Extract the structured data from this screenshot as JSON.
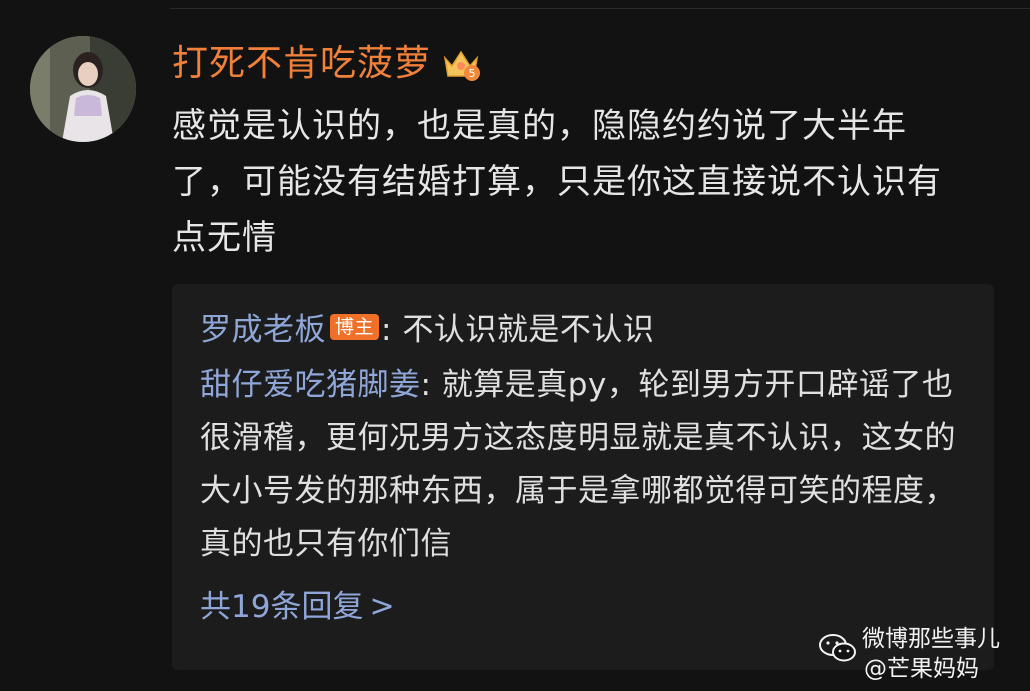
{
  "comment": {
    "username": "打死不肯吃菠萝",
    "badge_icon": "crown-level-badge-icon",
    "text": "感觉是认识的，也是真的，隐隐约约说了大半年了，可能没有结婚打算，只是你这直接说不认识有点无情"
  },
  "replies": [
    {
      "name": "罗成老板",
      "tag": "博主",
      "separator": ":",
      "text": " 不认识就是不认识"
    },
    {
      "name": "甜仔爱吃猪脚姜",
      "separator": ":",
      "text": " 就算是真py，轮到男方开口辟谣了也很滑稽，更何况男方这态度明显就是真不认识，这女的大小号发的那种东西，属于是拿哪都觉得可笑的程度，真的也只有你们信"
    }
  ],
  "more_replies": {
    "label": "共19条回复",
    "icon": "chevron-right-icon",
    "glyph": ">"
  },
  "watermark": {
    "line1": "微博那些事儿",
    "line2": "@芒果妈妈",
    "icon": "wechat-logo-icon"
  },
  "colors": {
    "background": "#121212",
    "username": "#f0803a",
    "reply_name": "#8fa6d9",
    "author_tag": "#f07028",
    "reply_box": "#1c1c1c"
  }
}
